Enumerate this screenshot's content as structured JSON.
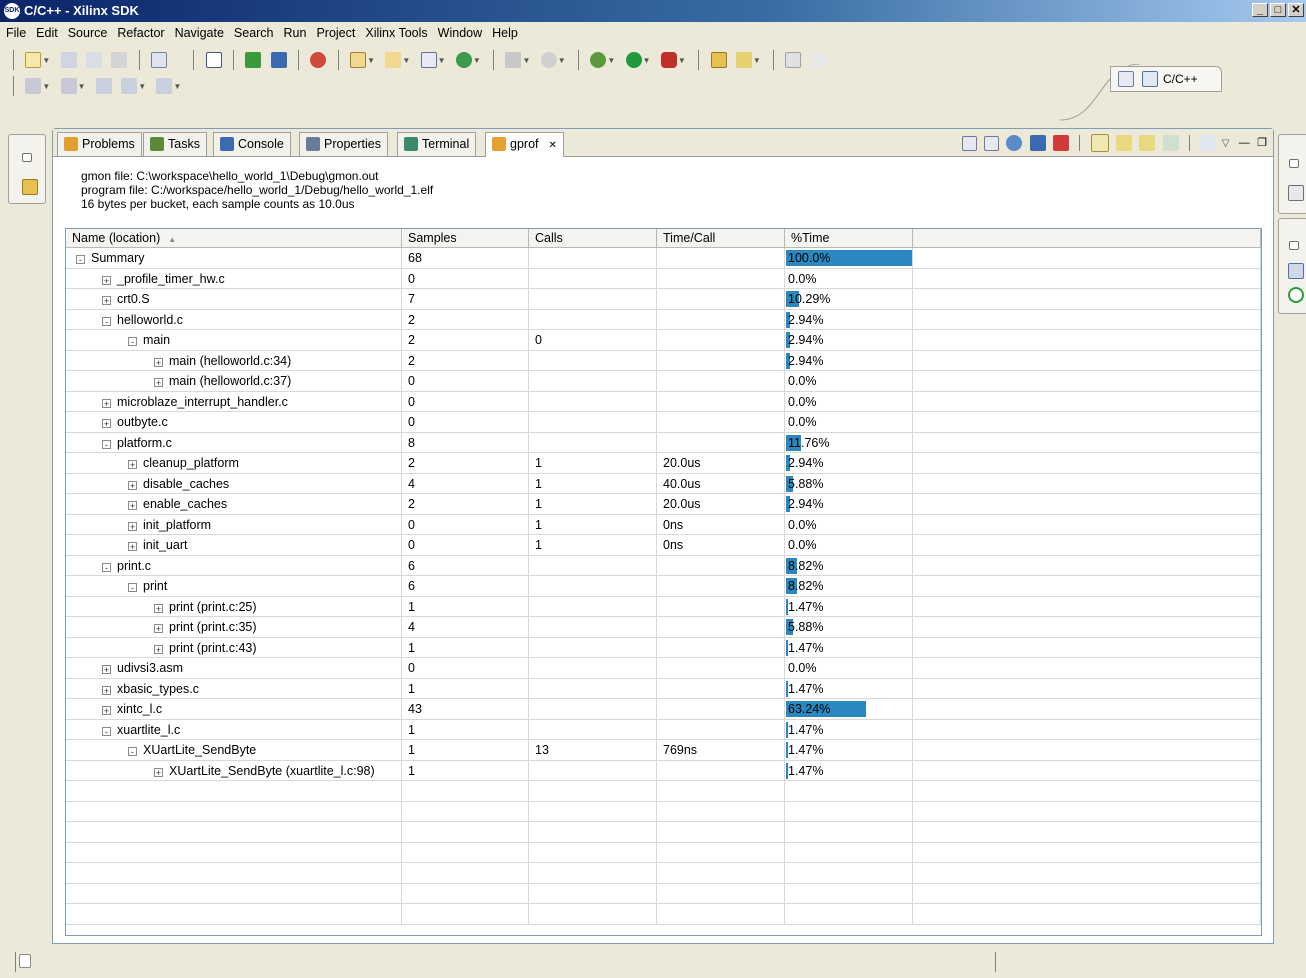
{
  "window": {
    "title": "C/C++ - Xilinx SDK",
    "icon_text": "SDK"
  },
  "menu": [
    "File",
    "Edit",
    "Source",
    "Refactor",
    "Navigate",
    "Search",
    "Run",
    "Project",
    "Xilinx Tools",
    "Window",
    "Help"
  ],
  "perspective": {
    "label": "C/C++"
  },
  "tabs": [
    {
      "label": "Problems",
      "icon": "problems-icon"
    },
    {
      "label": "Tasks",
      "icon": "tasks-icon"
    },
    {
      "label": "Console",
      "icon": "console-icon"
    },
    {
      "label": "Properties",
      "icon": "properties-icon"
    },
    {
      "label": "Terminal",
      "icon": "terminal-icon"
    },
    {
      "label": "gprof",
      "icon": "gprof-icon",
      "close": "✕"
    }
  ],
  "info": {
    "gmon": "gmon file: C:\\workspace\\hello_world_1\\Debug\\gmon.out",
    "program": "program file: C:/workspace/hello_world_1/Debug/hello_world_1.elf",
    "bucket": "16 bytes per bucket, each sample counts as 10.0us"
  },
  "columns": [
    "Name (location)",
    "Samples",
    "Calls",
    "Time/Call",
    "%Time"
  ],
  "sort_glyph": "▲",
  "rows": [
    {
      "depth": 0,
      "tw": "-",
      "name": "Summary",
      "samples": "68",
      "calls": "",
      "tpc": "",
      "pct": "100.0%",
      "pv": 100.0
    },
    {
      "depth": 1,
      "tw": "+",
      "name": "_profile_timer_hw.c",
      "samples": "0",
      "calls": "",
      "tpc": "",
      "pct": "0.0%",
      "pv": 0.0
    },
    {
      "depth": 1,
      "tw": "+",
      "name": "crt0.S",
      "samples": "7",
      "calls": "",
      "tpc": "",
      "pct": "10.29%",
      "pv": 10.29
    },
    {
      "depth": 1,
      "tw": "-",
      "name": "helloworld.c",
      "samples": "2",
      "calls": "",
      "tpc": "",
      "pct": "2.94%",
      "pv": 2.94
    },
    {
      "depth": 2,
      "tw": "-",
      "name": "main",
      "samples": "2",
      "calls": "0",
      "tpc": "",
      "pct": "2.94%",
      "pv": 2.94
    },
    {
      "depth": 3,
      "tw": "+",
      "name": "main (helloworld.c:34)",
      "samples": "2",
      "calls": "",
      "tpc": "",
      "pct": "2.94%",
      "pv": 2.94
    },
    {
      "depth": 3,
      "tw": "+",
      "name": "main (helloworld.c:37)",
      "samples": "0",
      "calls": "",
      "tpc": "",
      "pct": "0.0%",
      "pv": 0.0
    },
    {
      "depth": 1,
      "tw": "+",
      "name": "microblaze_interrupt_handler.c",
      "samples": "0",
      "calls": "",
      "tpc": "",
      "pct": "0.0%",
      "pv": 0.0
    },
    {
      "depth": 1,
      "tw": "+",
      "name": "outbyte.c",
      "samples": "0",
      "calls": "",
      "tpc": "",
      "pct": "0.0%",
      "pv": 0.0
    },
    {
      "depth": 1,
      "tw": "-",
      "name": "platform.c",
      "samples": "8",
      "calls": "",
      "tpc": "",
      "pct": "11.76%",
      "pv": 11.76
    },
    {
      "depth": 2,
      "tw": "+",
      "name": "cleanup_platform",
      "samples": "2",
      "calls": "1",
      "tpc": "20.0us",
      "pct": "2.94%",
      "pv": 2.94
    },
    {
      "depth": 2,
      "tw": "+",
      "name": "disable_caches",
      "samples": "4",
      "calls": "1",
      "tpc": "40.0us",
      "pct": "5.88%",
      "pv": 5.88
    },
    {
      "depth": 2,
      "tw": "+",
      "name": "enable_caches",
      "samples": "2",
      "calls": "1",
      "tpc": "20.0us",
      "pct": "2.94%",
      "pv": 2.94
    },
    {
      "depth": 2,
      "tw": "+",
      "name": "init_platform",
      "samples": "0",
      "calls": "1",
      "tpc": "0ns",
      "pct": "0.0%",
      "pv": 0.0
    },
    {
      "depth": 2,
      "tw": "+",
      "name": "init_uart",
      "samples": "0",
      "calls": "1",
      "tpc": "0ns",
      "pct": "0.0%",
      "pv": 0.0
    },
    {
      "depth": 1,
      "tw": "-",
      "name": "print.c",
      "samples": "6",
      "calls": "",
      "tpc": "",
      "pct": "8.82%",
      "pv": 8.82
    },
    {
      "depth": 2,
      "tw": "-",
      "name": "print",
      "samples": "6",
      "calls": "",
      "tpc": "",
      "pct": "8.82%",
      "pv": 8.82
    },
    {
      "depth": 3,
      "tw": "+",
      "name": "print (print.c:25)",
      "samples": "1",
      "calls": "",
      "tpc": "",
      "pct": "1.47%",
      "pv": 1.47
    },
    {
      "depth": 3,
      "tw": "+",
      "name": "print (print.c:35)",
      "samples": "4",
      "calls": "",
      "tpc": "",
      "pct": "5.88%",
      "pv": 5.88
    },
    {
      "depth": 3,
      "tw": "+",
      "name": "print (print.c:43)",
      "samples": "1",
      "calls": "",
      "tpc": "",
      "pct": "1.47%",
      "pv": 1.47
    },
    {
      "depth": 1,
      "tw": "+",
      "name": "udivsi3.asm",
      "samples": "0",
      "calls": "",
      "tpc": "",
      "pct": "0.0%",
      "pv": 0.0
    },
    {
      "depth": 1,
      "tw": "+",
      "name": "xbasic_types.c",
      "samples": "1",
      "calls": "",
      "tpc": "",
      "pct": "1.47%",
      "pv": 1.47
    },
    {
      "depth": 1,
      "tw": "+",
      "name": "xintc_l.c",
      "samples": "43",
      "calls": "",
      "tpc": "",
      "pct": "63.24%",
      "pv": 63.24
    },
    {
      "depth": 1,
      "tw": "-",
      "name": "xuartlite_l.c",
      "samples": "1",
      "calls": "",
      "tpc": "",
      "pct": "1.47%",
      "pv": 1.47
    },
    {
      "depth": 2,
      "tw": "-",
      "name": "XUartLite_SendByte",
      "samples": "1",
      "calls": "13",
      "tpc": "769ns",
      "pct": "1.47%",
      "pv": 1.47
    },
    {
      "depth": 3,
      "tw": "+",
      "name": "XUartLite_SendByte (xuartlite_l.c:98)",
      "samples": "1",
      "calls": "",
      "tpc": "",
      "pct": "1.47%",
      "pv": 1.47
    }
  ],
  "colors": {
    "bar": "#2a87c0",
    "titlebar": "#0a246a"
  }
}
